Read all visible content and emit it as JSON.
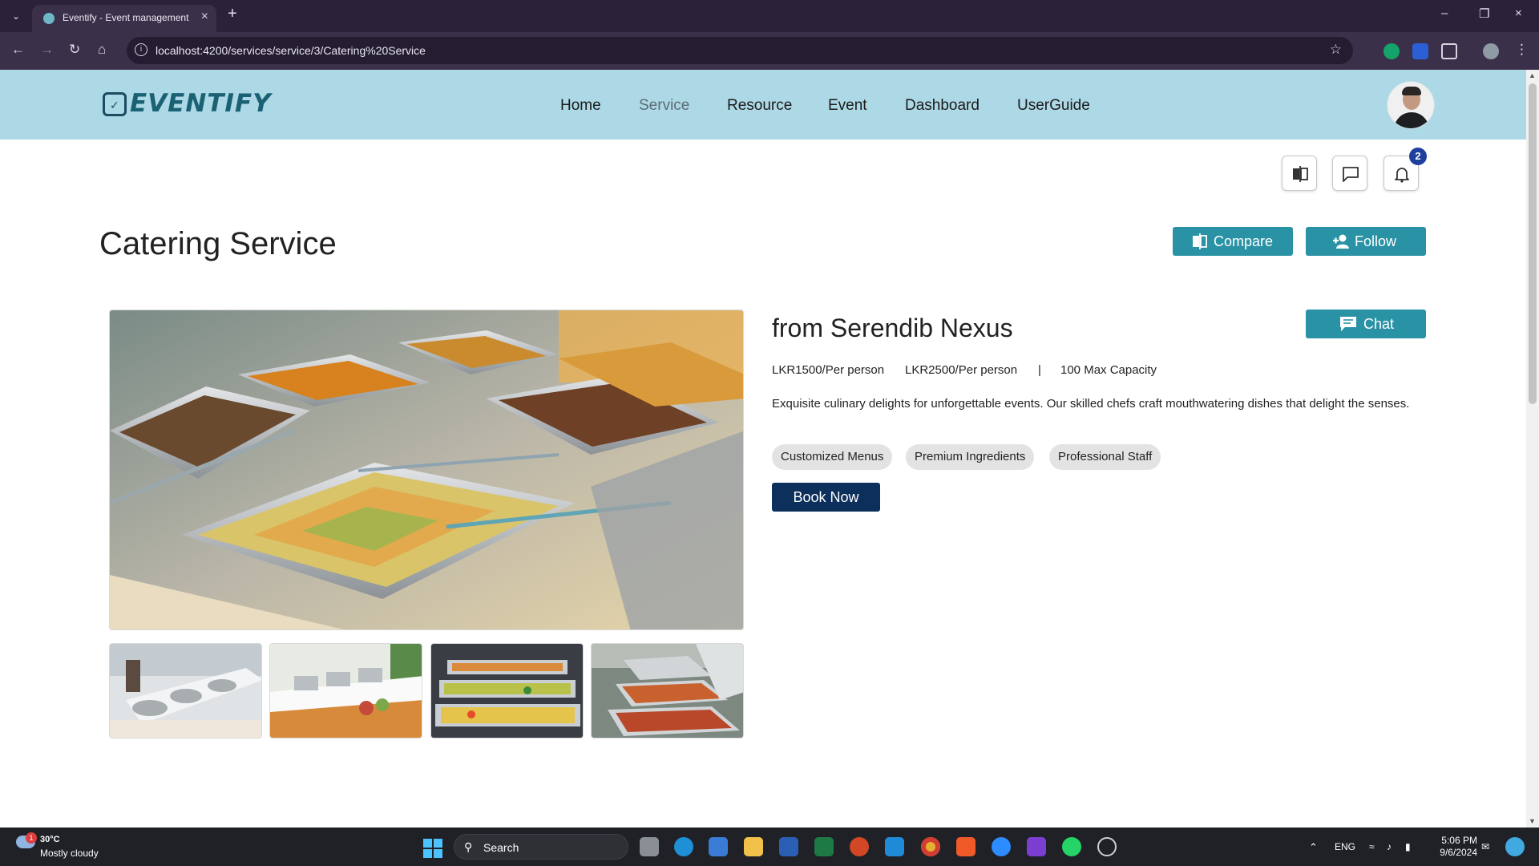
{
  "browser": {
    "tab_title": "Eventify - Event management sys",
    "url": "localhost:4200/services/service/3/Catering%20Service"
  },
  "header": {
    "logo_text": "EVENTIFY",
    "nav": [
      "Home",
      "Service",
      "Resource",
      "Event",
      "Dashboard",
      "UserGuide"
    ],
    "active_nav": "Service"
  },
  "toolbar": {
    "notification_count": "2"
  },
  "page": {
    "title": "Catering Service",
    "compare_label": "Compare",
    "follow_label": "Follow",
    "chat_label": "Chat"
  },
  "service": {
    "vendor": "from Serendib Nexus",
    "price_1": "LKR1500/Per person",
    "price_2": "LKR2500/Per person",
    "separator": "|",
    "capacity": "100 Max Capacity",
    "description": "Exquisite culinary delights for unforgettable events. Our skilled chefs craft mouthwatering dishes that delight the senses.",
    "features": [
      "Customized Menus",
      "Premium Ingredients",
      "Professional Staff"
    ],
    "book_label": "Book Now"
  },
  "taskbar": {
    "temperature": "30°C",
    "weather": "Mostly cloudy",
    "weather_badge": "1",
    "search_label": "Search",
    "language": "ENG",
    "time": "5:06 PM",
    "date": "9/6/2024"
  },
  "colors": {
    "header_bg": "#add8e6",
    "accent_teal": "#2a92a5",
    "book_navy": "#0d2f5c",
    "badge_blue": "#1f3f9e"
  }
}
